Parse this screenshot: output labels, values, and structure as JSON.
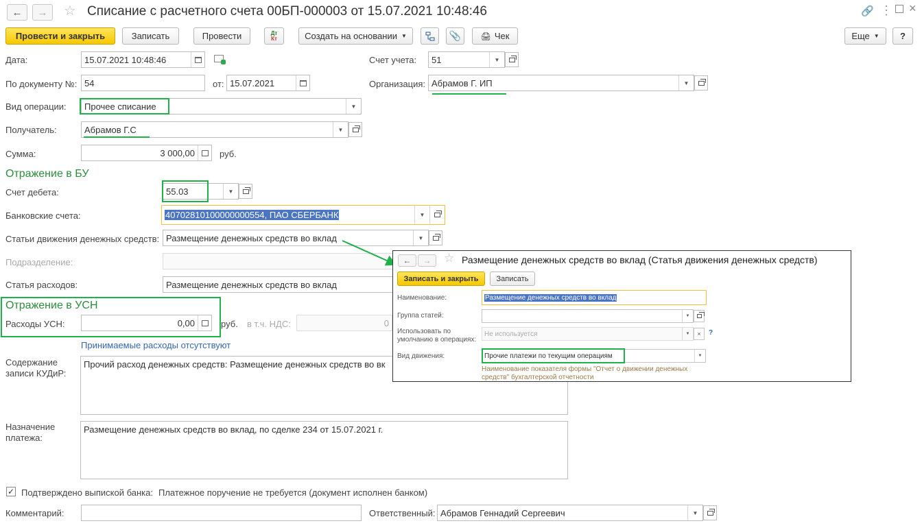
{
  "window": {
    "title": "Списание с расчетного счета 00БП-000003 от 15.07.2021 10:48:46"
  },
  "toolbar": {
    "post_close": "Провести и закрыть",
    "save": "Записать",
    "post": "Провести",
    "dtkt_top": "Дт",
    "dtkt_bottom": "Кт",
    "create_based": "Создать на основании",
    "receipt": "Чек",
    "more": "Еще",
    "help": "?"
  },
  "form": {
    "date_label": "Дата:",
    "date_value": "15.07.2021 10:48:46",
    "doc_no_label": "По документу №:",
    "doc_no_value": "54",
    "from_label": "от:",
    "from_value": "15.07.2021",
    "account_label": "Счет учета:",
    "account_value": "51",
    "org_label": "Организация:",
    "org_value": "Абрамов Г. ИП",
    "op_type_label": "Вид операции:",
    "op_type_value": "Прочее списание",
    "recipient_label": "Получатель:",
    "recipient_value": "Абрамов Г.С",
    "sum_label": "Сумма:",
    "sum_value": "3 000,00",
    "currency": "руб."
  },
  "bu": {
    "section_title": "Отражение в БУ",
    "debit_label": "Счет дебета:",
    "debit_value": "55.03",
    "bank_label": "Банковские счета:",
    "bank_value": "40702810100000000554, ПАО СБЕРБАНК",
    "cashflow_label": "Статьи движения денежных средств:",
    "cashflow_value": "Размещение денежных средств во вклад",
    "division_label": "Подразделение:",
    "expense_label": "Статья расходов:",
    "expense_value": "Размещение денежных средств во вклад"
  },
  "usn": {
    "section_title": "Отражение в УСН",
    "expenses_label": "Расходы УСН:",
    "expenses_value": "0,00",
    "currency": "руб.",
    "vat_label": "в т.ч. НДС:",
    "vat_value": "0",
    "link": "Принимаемые расходы отсутствуют"
  },
  "kudir": {
    "label_line1": "Содержание",
    "label_line2": "записи КУДиР:",
    "value": "Прочий расход денежных средств: Размещение денежных средств во вк"
  },
  "purpose": {
    "label_line1": "Назначение",
    "label_line2": "платежа:",
    "value": "Размещение денежных средств во вклад, по сделке 234 от 15.07.2021 г."
  },
  "footer": {
    "confirmed_label": "Подтверждено выпиской банка:",
    "confirmed_text": "Платежное поручение не требуется (документ исполнен банком)",
    "comment_label": "Комментарий:",
    "responsible_label": "Ответственный:",
    "responsible_value": "Абрамов Геннадий Сергеевич"
  },
  "popup": {
    "title": "Размещение денежных средств во вклад (Статья движения денежных средств)",
    "save_close": "Записать и закрыть",
    "save": "Записать",
    "name_label": "Наименование:",
    "name_value": "Размещение денежных средств во вклад",
    "group_label": "Группа статей:",
    "default_label_line1": "Использовать по",
    "default_label_line2": "умолчанию в операциях:",
    "default_value": "Не используется",
    "movement_label": "Вид движения:",
    "movement_value": "Прочие платежи по текущим операциям",
    "hint": "Наименование показателя формы \"Отчет о движении денежных средств\" бухгалтерской отчетности",
    "q": "?",
    "x": "×"
  },
  "colors": {
    "highlight_green": "#1fb24a",
    "section_green": "#2e8b3e",
    "primary_yellow": "#f6c700",
    "focus_orange": "#f3c03a",
    "link_blue": "#3467ae"
  }
}
